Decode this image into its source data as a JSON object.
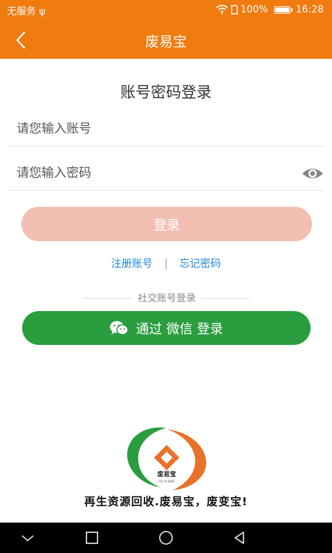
{
  "status_bar": {
    "carrier": "无服务",
    "battery": "100%",
    "battery_level": 1.0,
    "time": "16:28"
  },
  "header": {
    "title": "废易宝"
  },
  "login": {
    "title": "账号密码登录",
    "account_placeholder": "请您输入账号",
    "account_value": "",
    "password_placeholder": "请您输入密码",
    "password_value": "",
    "login_button": "登录"
  },
  "links": {
    "register": "注册账号",
    "separator": "|",
    "forgot_password": "忘记密码"
  },
  "social": {
    "divider_label": "社交账号登录",
    "wechat_button": "通过 微信 登录"
  },
  "logo": {
    "brand_text": "废易宝",
    "brand_pinyin": "FEI YI BAO",
    "slogan": "再生资源回收.废易宝，废变宝!"
  },
  "colors": {
    "primary": "#f07b0f",
    "login_button_disabled": "#f3bfb2",
    "link": "#1f86d8",
    "wechat": "#2a9d3f"
  },
  "icons": {
    "back": "chevron-left-icon",
    "visibility": "eye-icon",
    "wechat": "wechat-icon",
    "nav_back": "triangle-back-icon",
    "nav_home": "circle-home-icon",
    "nav_recent": "square-recent-icon",
    "nav_collapse": "chevron-down-icon"
  }
}
